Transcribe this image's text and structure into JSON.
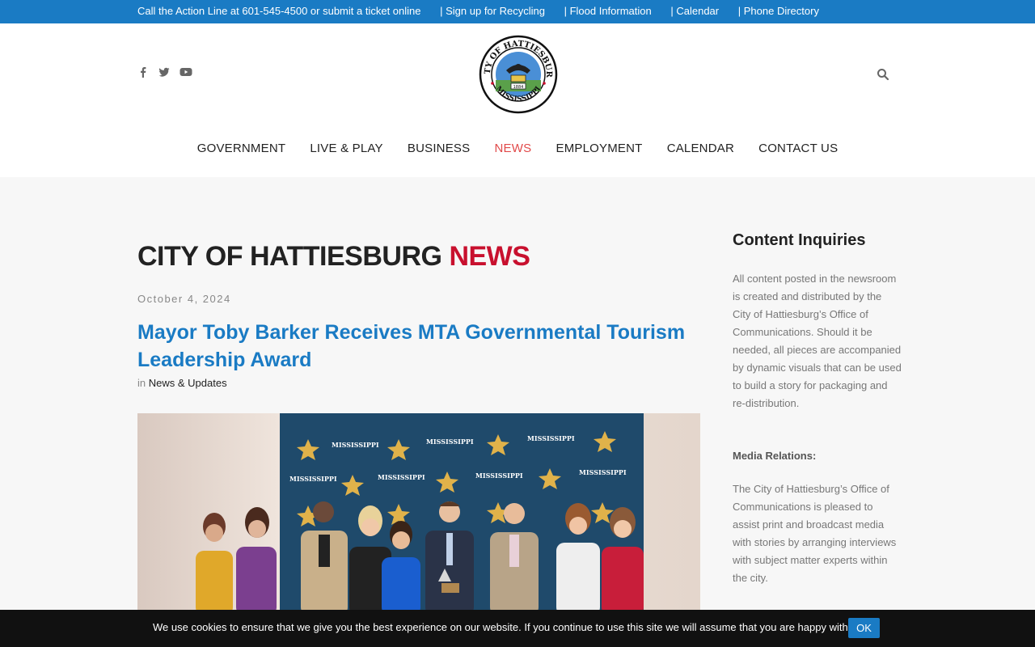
{
  "topbar": {
    "action_line": "Call the Action Line at 601-545-4500 or submit a ticket online",
    "links": [
      "| Sign up for Recycling",
      "| Flood Information",
      "| Calendar",
      "| Phone Directory"
    ]
  },
  "header": {
    "social_icons": [
      "facebook-icon",
      "twitter-icon",
      "youtube-icon"
    ],
    "seal_text_top": "CITY OF HATTIESBURG",
    "seal_text_bottom": "MISSISSIPPI",
    "seal_year": "1884"
  },
  "nav": {
    "items": [
      "GOVERNMENT",
      "LIVE & PLAY",
      "BUSINESS",
      "NEWS",
      "EMPLOYMENT",
      "CALENDAR",
      "CONTACT US"
    ],
    "active": "NEWS"
  },
  "page": {
    "title_main": "CITY OF HATTIESBURG",
    "title_accent": "NEWS"
  },
  "post": {
    "date": "October 4, 2024",
    "title": "Mayor Toby Barker Receives MTA Governmental Tourism Leadership Award",
    "meta_prefix": "in",
    "category": "News & Updates",
    "backdrop_text": "MISSISSIPPI"
  },
  "sidebar": {
    "title": "Content Inquiries",
    "para1": "All content posted in the newsroom is created and distributed by the City of Hattiesburg’s Office of Communications. Should it be needed, all pieces are accompanied by dynamic visuals that can be used to build a story for packaging and re-distribution.",
    "media_heading": "Media Relations:",
    "para2": "The City of Hattiesburg’s Office of Communications is pleased to assist print and broadcast media with stories by arranging interviews with subject matter experts within the city."
  },
  "cookie": {
    "message": "We use cookies to ensure that we give you the best experience on our website. If you continue to use this site we will assume that you are happy with it.",
    "ok_label": "OK"
  },
  "colors": {
    "brand_blue": "#1a7bc4",
    "accent_red": "#c8102e",
    "nav_active": "#e14a4a"
  }
}
